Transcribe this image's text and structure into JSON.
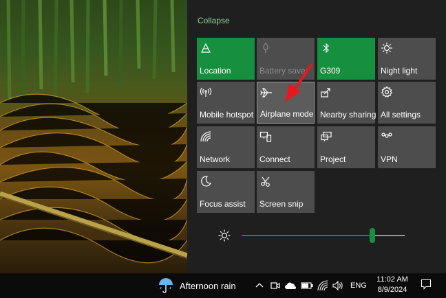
{
  "action_center": {
    "collapse_label": "Collapse",
    "tiles": [
      {
        "label": "Location",
        "icon": "location-icon",
        "state": "on"
      },
      {
        "label": "Battery saver",
        "icon": "battery-saver-icon",
        "state": "disabled"
      },
      {
        "label": "G309",
        "icon": "bluetooth-icon",
        "state": "on"
      },
      {
        "label": "Night light",
        "icon": "night-light-icon",
        "state": "off"
      },
      {
        "label": "Mobile hotspot",
        "icon": "mobile-hotspot-icon",
        "state": "off"
      },
      {
        "label": "Airplane mode",
        "icon": "airplane-icon",
        "state": "off"
      },
      {
        "label": "Nearby sharing",
        "icon": "nearby-sharing-icon",
        "state": "off"
      },
      {
        "label": "All settings",
        "icon": "gear-icon",
        "state": "off"
      },
      {
        "label": "Network",
        "icon": "network-icon",
        "state": "off"
      },
      {
        "label": "Connect",
        "icon": "connect-icon",
        "state": "off"
      },
      {
        "label": "Project",
        "icon": "project-icon",
        "state": "off"
      },
      {
        "label": "VPN",
        "icon": "vpn-icon",
        "state": "off"
      },
      {
        "label": "Focus assist",
        "icon": "moon-icon",
        "state": "off"
      },
      {
        "label": "Screen snip",
        "icon": "screen-snip-icon",
        "state": "off"
      }
    ],
    "brightness": {
      "icon": "sun-icon",
      "value_percent": 80
    }
  },
  "taskbar": {
    "weather": {
      "label": "Afternoon rain",
      "icon": "umbrella-rain-icon"
    },
    "tray_icons": [
      "chevron-up-icon",
      "meet-now-icon",
      "onedrive-cloud-icon",
      "battery-icon",
      "wifi-icon",
      "volume-icon"
    ],
    "language": "ENG",
    "time": "11:02 AM",
    "date": "8/9/2024",
    "notification_icon": "notification-icon"
  },
  "colors": {
    "accent": "#16903f",
    "tile_off": "#4d4d4d",
    "panel_bg": "#1f1f1f",
    "taskbar_bg": "#0b0b0b",
    "collapse_text": "#8fd19e",
    "annotation_arrow": "#e8171b"
  }
}
